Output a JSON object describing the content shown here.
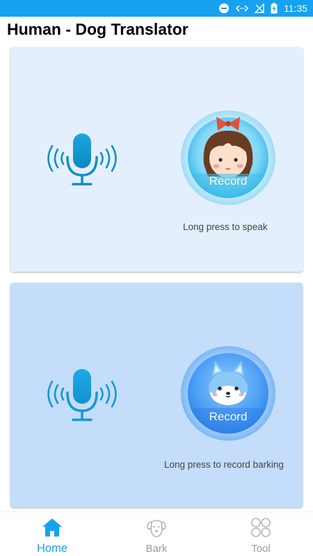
{
  "status_bar": {
    "time": "11:35"
  },
  "header": {
    "title": "Human - Dog Translator"
  },
  "human_card": {
    "record_label": "Record",
    "hint": "Long press to speak"
  },
  "dog_card": {
    "record_label": "Record",
    "hint": "Long press to record barking"
  },
  "nav": {
    "items": [
      {
        "label": "Home",
        "icon": "home-icon",
        "active": true
      },
      {
        "label": "Bark",
        "icon": "dog-icon",
        "active": false
      },
      {
        "label": "Tool",
        "icon": "grid-icon",
        "active": false
      }
    ]
  },
  "colors": {
    "accent": "#16a2f0",
    "human_card_bg": "#e4effd",
    "dog_card_bg": "#c3ddfa",
    "inactive_nav": "#9a9a9a"
  }
}
